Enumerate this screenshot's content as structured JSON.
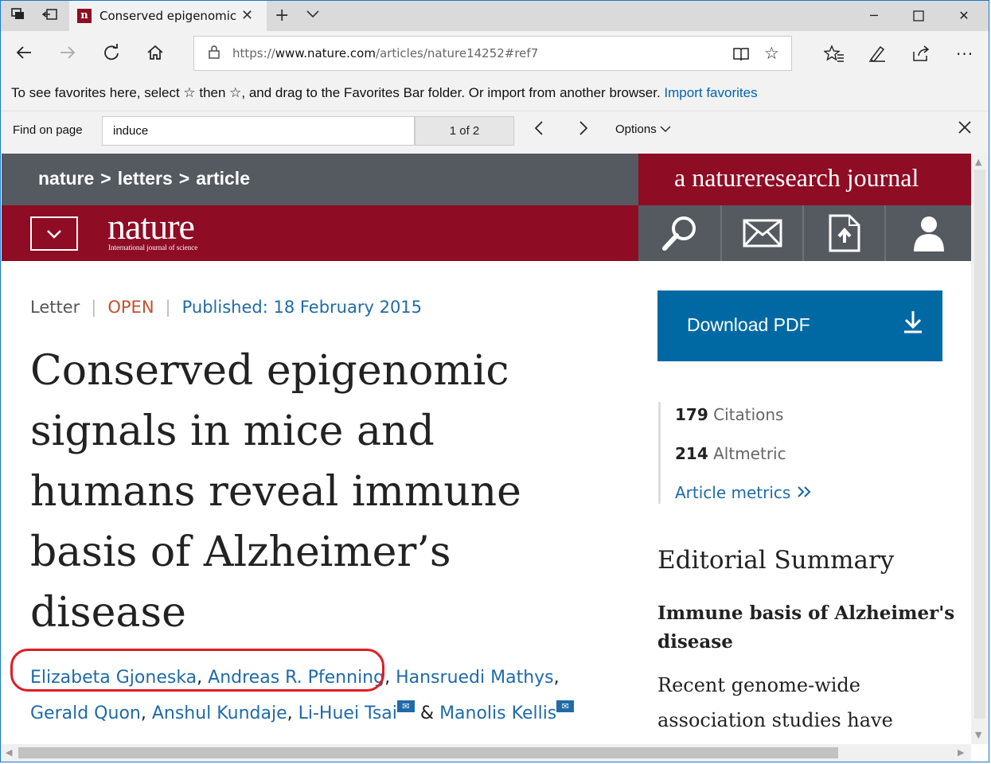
{
  "browser": {
    "tab_title": "Conserved epigenomic",
    "url_prefix": "https://",
    "url_domain": "www.nature.com",
    "url_path": "/articles/nature14252#ref7",
    "favorites_bar_text": "To see favorites here, select  ☆  then ☆, and drag to the Favorites Bar folder. Or import from another browser. ",
    "import_favorites": "Import favorites",
    "find": {
      "label": "Find on page",
      "query": "induce",
      "count": "1 of 2",
      "options": "Options"
    }
  },
  "site": {
    "breadcrumb": [
      "nature",
      "letters",
      "article"
    ],
    "network_label": "a natureresearch journal",
    "logo": "nature",
    "logo_sub": "International journal of science"
  },
  "article": {
    "type": "Letter",
    "access": "OPEN",
    "published": "Published: 18 February 2015",
    "title": "Conserved epigenomic signals in mice and humans reveal immune basis of Alzheimer’s disease",
    "authors": [
      "Elizabeta Gjoneska",
      "Andreas R. Pfenning",
      "Hansruedi Mathys",
      "Gerald Quon",
      "Anshul Kundaje",
      "Li-Huei Tsai",
      "Manolis Kellis"
    ],
    "and": "&"
  },
  "sidebar": {
    "download_label": "Download PDF",
    "citations_count": "179",
    "citations_label": "Citations",
    "altmetric_count": "214",
    "altmetric_label": "Altmetric",
    "metrics_link": "Article metrics",
    "editorial_title": "Editorial Summary",
    "editorial_headline": "Immune basis of Alzheimer's disease",
    "editorial_body": "Recent genome-wide association studies have"
  },
  "colors": {
    "nature_red": "#8e0c24",
    "grey_bar": "#555a61",
    "link_blue": "#1f6aa8",
    "download_blue": "#0069a3",
    "open_orange": "#c4502b",
    "highlight_red": "#e31b23"
  }
}
